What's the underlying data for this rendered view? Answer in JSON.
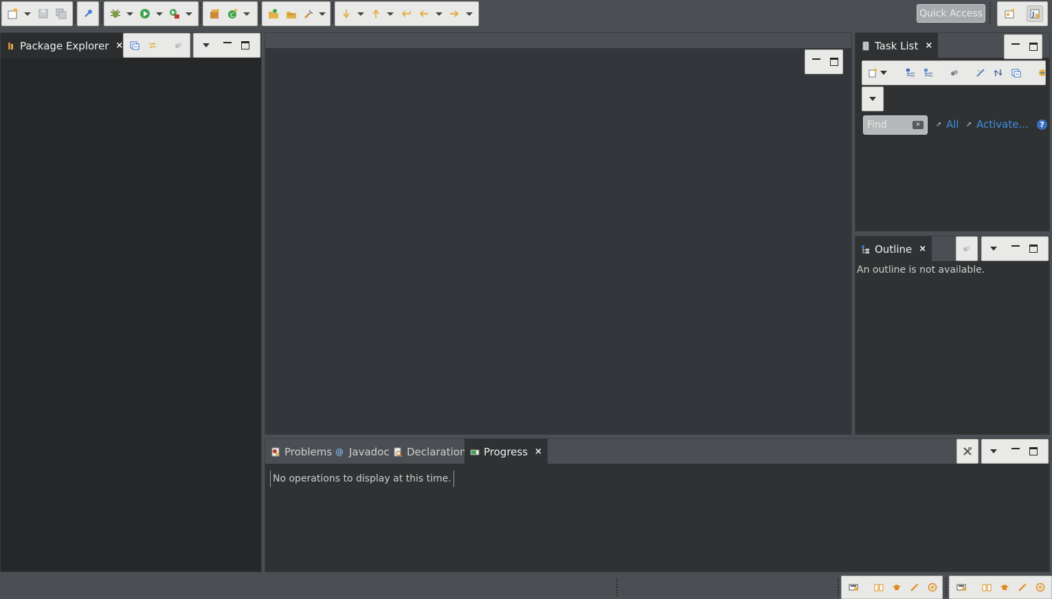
{
  "toolbar": {
    "quick_access_label": "Quick Access"
  },
  "package_explorer": {
    "tab_label": "Package Explorer",
    "close_glyph": "×"
  },
  "task_list": {
    "tab_label": "Task List",
    "close_glyph": "×",
    "find_placeholder": "Find",
    "filter_all": "All",
    "filter_activate": "Activate...",
    "help_glyph": "?"
  },
  "outline": {
    "tab_label": "Outline",
    "close_glyph": "×",
    "empty_message": "An outline is not available."
  },
  "bottom_panel": {
    "tabs": [
      {
        "label": "Problems",
        "icon": "problems-icon"
      },
      {
        "label": "Javadoc",
        "icon": "javadoc-icon"
      },
      {
        "label": "Declaration",
        "icon": "declaration-icon"
      },
      {
        "label": "Progress",
        "icon": "progress-icon"
      }
    ],
    "active_tab": "Progress",
    "close_glyph": "×",
    "progress_message": "No operations to display at this time."
  },
  "colors": {
    "workbench_bg": "#4b4f54",
    "panel_bg": "#2f3133",
    "toolbar_bg": "#e9e9e7",
    "link": "#3d8fe0"
  }
}
